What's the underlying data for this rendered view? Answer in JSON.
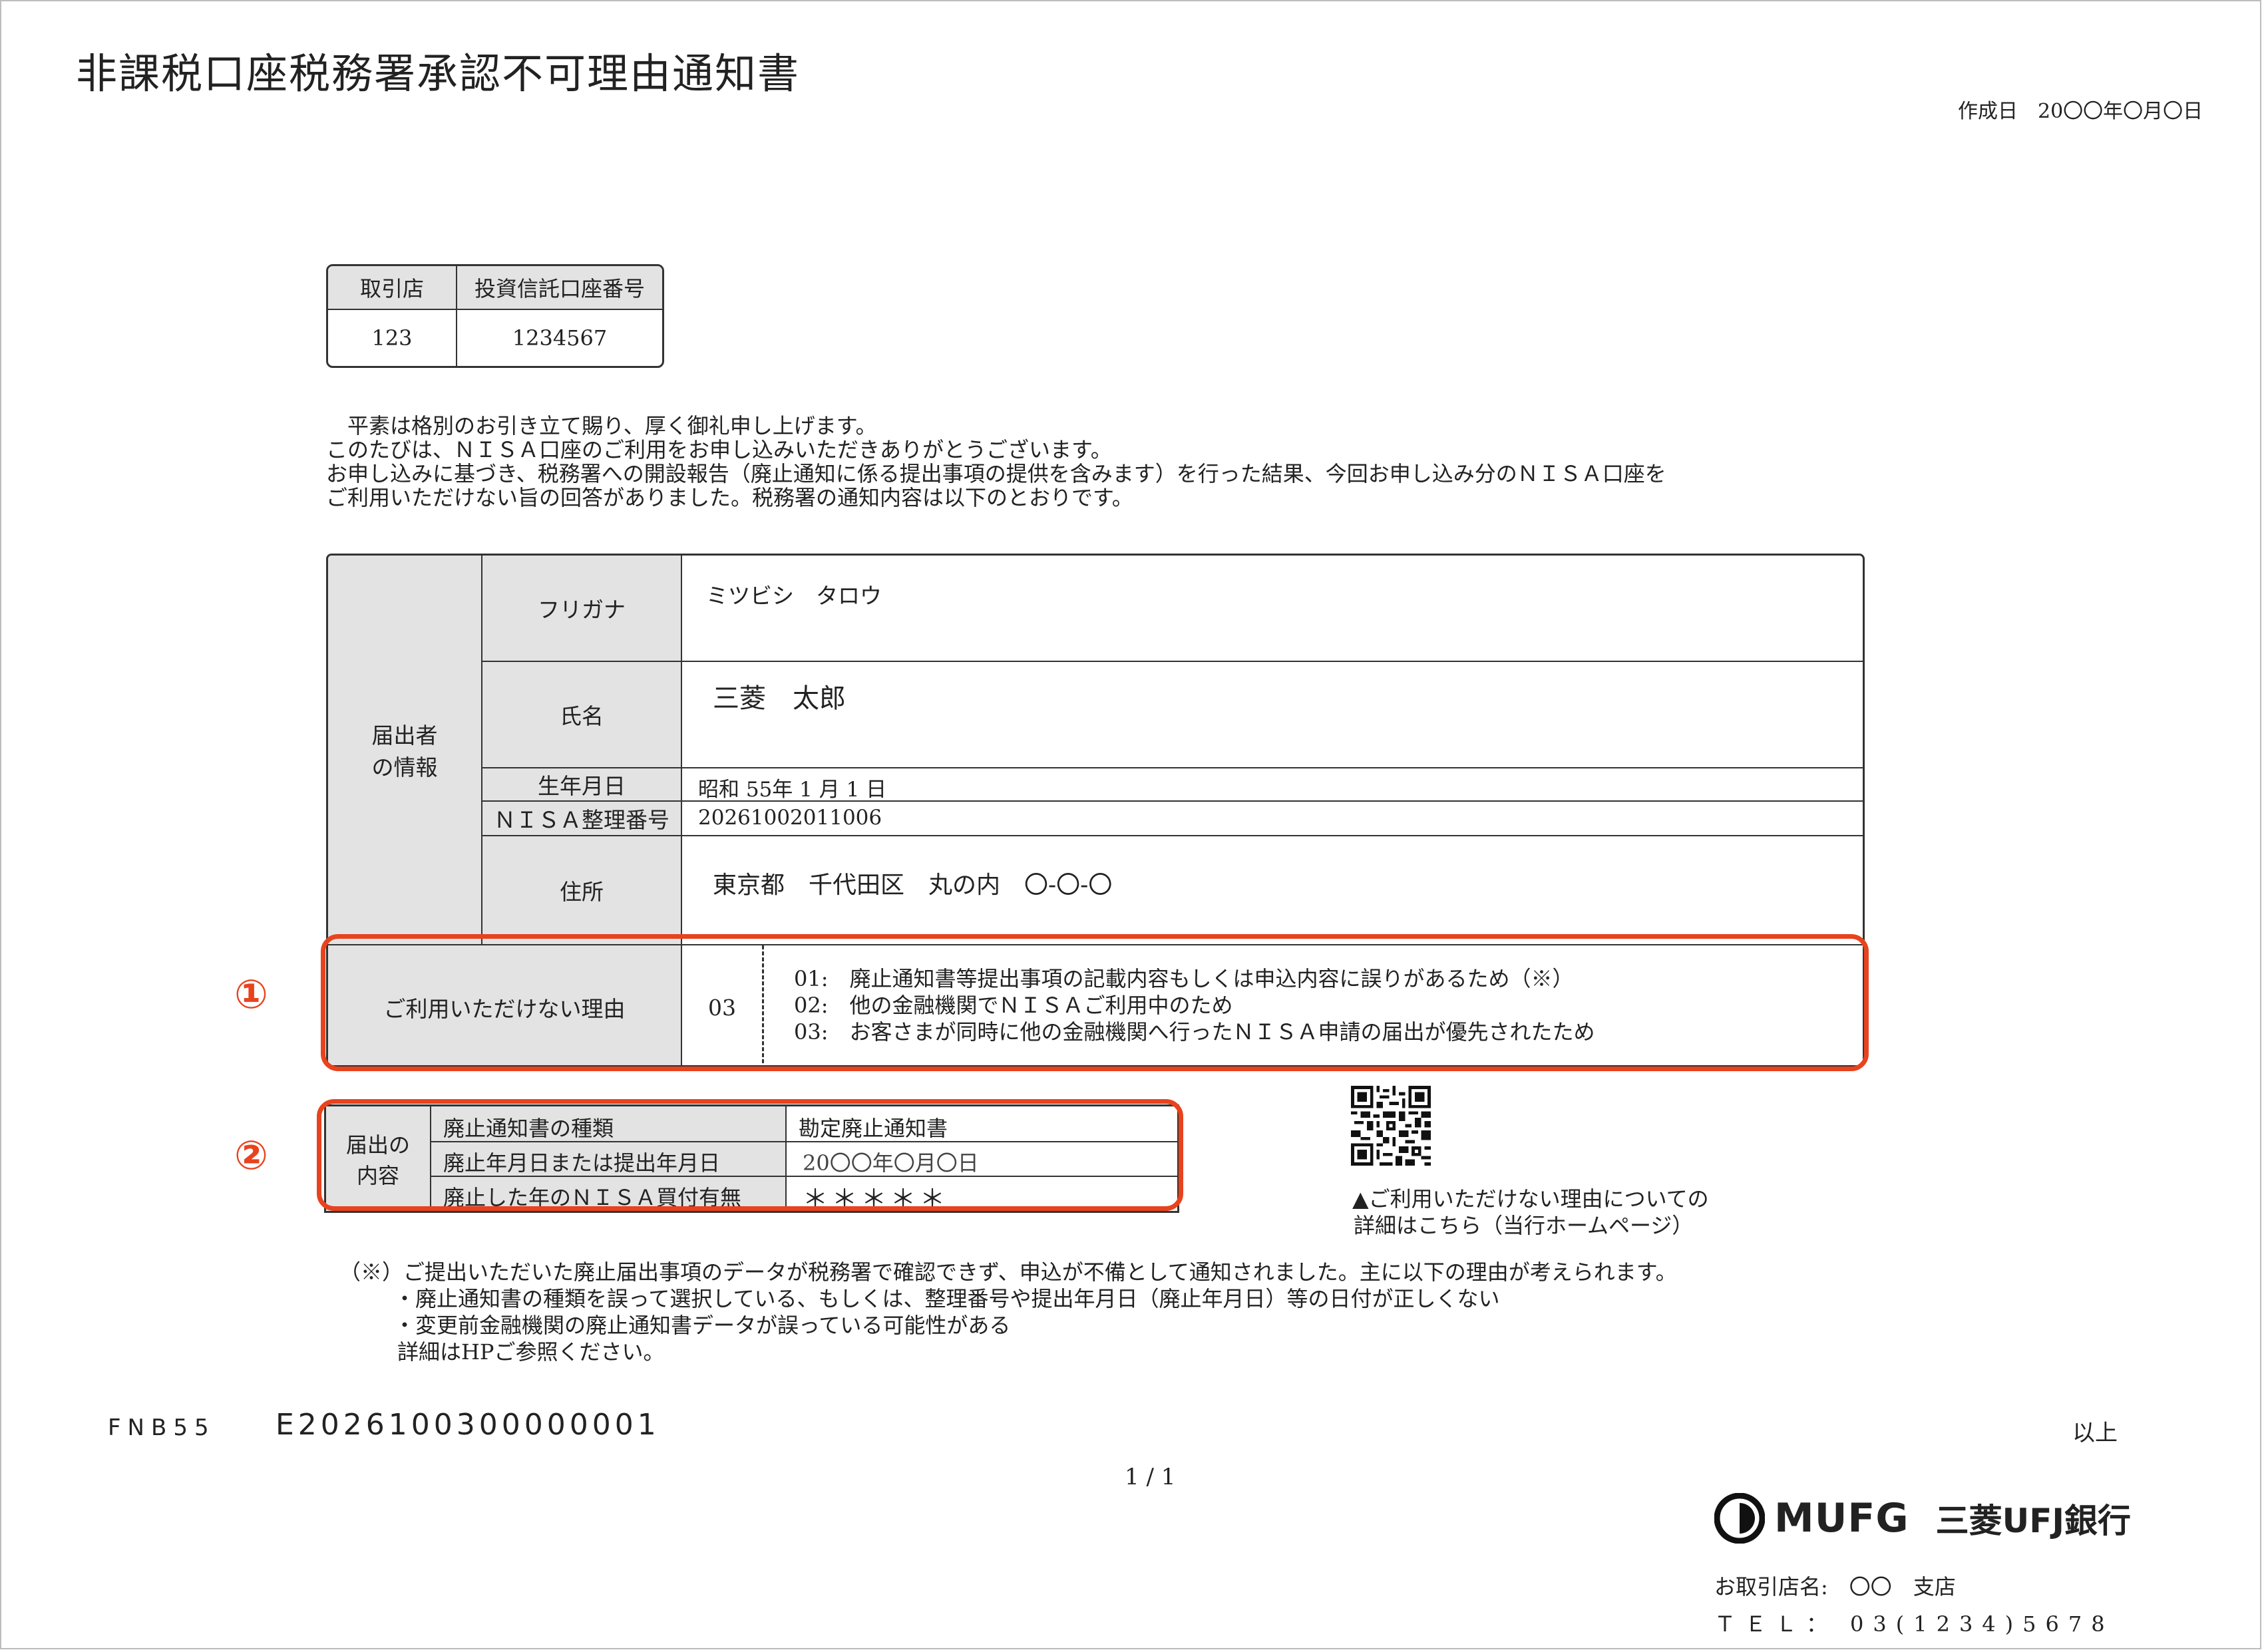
{
  "document": {
    "title": "非課税口座税務署承認不可理由通知書",
    "created_label": "作成日",
    "created_value": "20〇〇年〇月〇日"
  },
  "account": {
    "branch_header": "取引店",
    "number_header": "投資信託口座番号",
    "branch_value": "123",
    "number_value": "1234567"
  },
  "intro_lines": [
    "　平素は格別のお引き立て賜り、厚く御礼申し上げます。",
    "このたびは、ＮＩＳＡ口座のご利用をお申し込みいただきありがとうございます。",
    "お申し込みに基づき、税務署への開設報告（廃止通知に係る提出事項の提供を含みます）を行った結果、今回お申し込み分のＮＩＳＡ口座を",
    "ご利用いただけない旨の回答がありました。税務署の通知内容は以下のとおりです。"
  ],
  "applicant": {
    "group_label_1": "届出者",
    "group_label_2": "の情報",
    "furigana_label": "フリガナ",
    "furigana_value": "ミツビシ　タロウ",
    "name_label": "氏名",
    "name_value": "三菱　太郎",
    "birth_label": "生年月日",
    "birth_value": "昭和 55年 1 月 1 日",
    "nisa_label": "ＮＩＳＡ整理番号",
    "nisa_value": "20261002011006",
    "address_label": "住所",
    "address_value": "東京都　千代田区　丸の内　〇-〇-〇"
  },
  "reason": {
    "marker": "①",
    "label": "ご利用いただけない理由",
    "code": "03",
    "lines": [
      "01:　廃止通知書等提出事項の記載内容もしくは申込内容に誤りがあるため（※）",
      "02:　他の金融機関でＮＩＳＡご利用中のため",
      "03:　お客さまが同時に他の金融機関へ行ったＮＩＳＡ申請の届出が優先されたため"
    ]
  },
  "notice": {
    "marker": "②",
    "group_label_1": "届出の",
    "group_label_2": "内容",
    "rows": [
      {
        "label": "廃止通知書の種類",
        "value": "勘定廃止通知書"
      },
      {
        "label": "廃止年月日または提出年月日",
        "value": "20〇〇年〇月〇日"
      },
      {
        "label": "廃止した年のＮＩＳＡ買付有無",
        "value": "＊＊＊＊＊"
      }
    ]
  },
  "qr_note": [
    "▲ご利用いただけない理由についての",
    "詳細はこちら（当行ホームページ）"
  ],
  "footnote": [
    "（※）ご提出いただいた廃止届出事項のデータが税務署で確認できず、申込が不備として通知されました。主に以下の理由が考えられます。",
    "・廃止通知書の種類を誤って選択している、もしくは、整理番号や提出年月日（廃止年月日）等の日付が正しくない",
    "・変更前金融機関の廃止通知書データが誤っている可能性がある",
    "詳細はHPご参照ください。"
  ],
  "codes": {
    "form_code": "FNB55",
    "doc_number": "E2026100300000001",
    "end_mark": "以上",
    "page_number": "1 / 1"
  },
  "bank": {
    "logo_text": "MUFG",
    "bank_name": "三菱UFJ銀行",
    "branch_label": "お取引店名:",
    "branch_name": "〇〇",
    "branch_suffix": "支店",
    "tel_label": "ＴＥＬ：",
    "tel_value": "03(1234)5678"
  }
}
